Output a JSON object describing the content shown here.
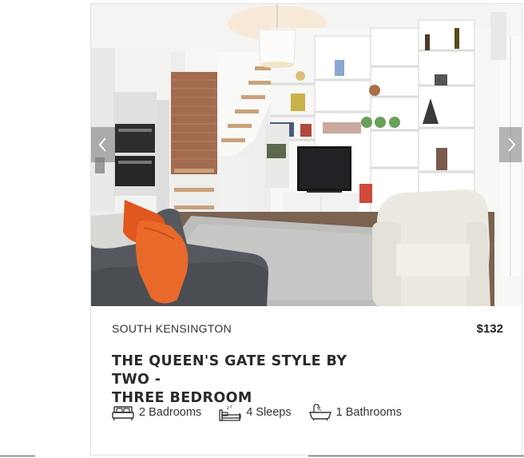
{
  "listing": {
    "location": "SOUTH KENSINGTON",
    "price": "$132",
    "title_line1": "THE QUEEN'S GATE STYLE BY TWO -",
    "title_line2": "THREE BEDROOM",
    "amenities": [
      {
        "icon": "bed-icon",
        "label": "2 Badrooms"
      },
      {
        "icon": "sleep-icon",
        "label": "4 Sleeps"
      },
      {
        "icon": "bathtub-icon",
        "label": "1 Bathrooms"
      }
    ]
  },
  "gallery": {
    "prev_icon": "chevron-left-icon",
    "next_icon": "chevron-right-icon",
    "photo_subject": "living-room-photo"
  },
  "colors": {
    "accent_cushion": "#e8692a",
    "sofa": "#55585e",
    "text": "#333333"
  }
}
